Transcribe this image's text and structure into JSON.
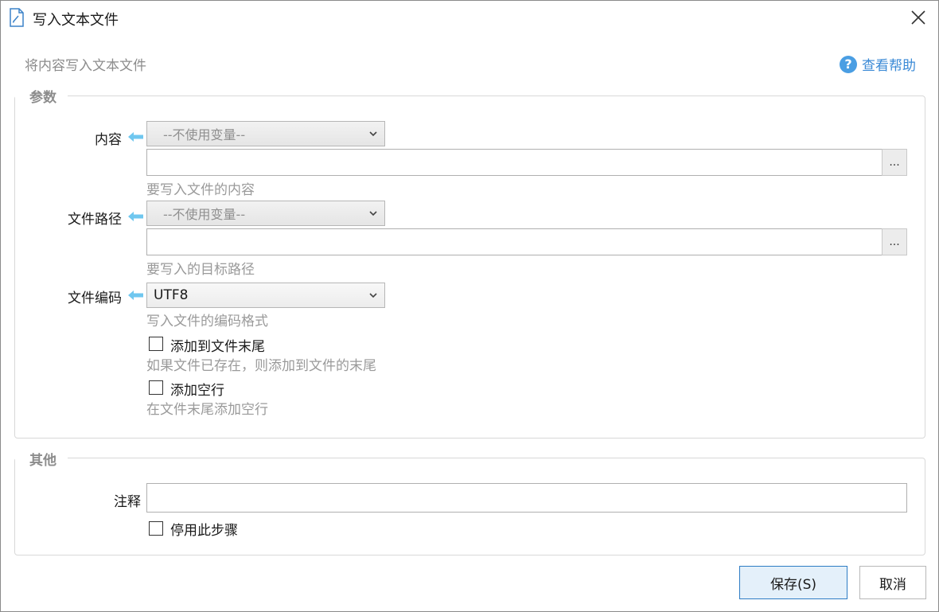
{
  "window": {
    "title": "写入文本文件"
  },
  "header": {
    "subtitle": "将内容写入文本文件",
    "help_label": "查看帮助"
  },
  "params": {
    "group_title": "参数",
    "content": {
      "label": "内容",
      "variable_placeholder": "--不使用变量--",
      "value": "",
      "hint": "要写入文件的内容",
      "browse_label": "..."
    },
    "file_path": {
      "label": "文件路径",
      "variable_placeholder": "--不使用变量--",
      "value": "",
      "hint": "要写入的目标路径",
      "browse_label": "..."
    },
    "encoding": {
      "label": "文件编码",
      "selected": "UTF8",
      "hint": "写入文件的编码格式"
    },
    "append": {
      "label": "添加到文件末尾",
      "hint": "如果文件已存在，则添加到文件的末尾",
      "checked": false
    },
    "add_blank_line": {
      "label": "添加空行",
      "hint": "在文件末尾添加空行",
      "checked": false
    }
  },
  "other": {
    "group_title": "其他",
    "comment": {
      "label": "注释",
      "value": ""
    },
    "disable_step": {
      "label": "停用此步骤",
      "checked": false
    }
  },
  "footer": {
    "save_label": "保存(S)",
    "cancel_label": "取消"
  },
  "colors": {
    "accent": "#2d7cc4",
    "help_blue": "#4a9ee3",
    "arrow_blue": "#6fc7ef",
    "hint_gray": "#9a9a9a"
  }
}
